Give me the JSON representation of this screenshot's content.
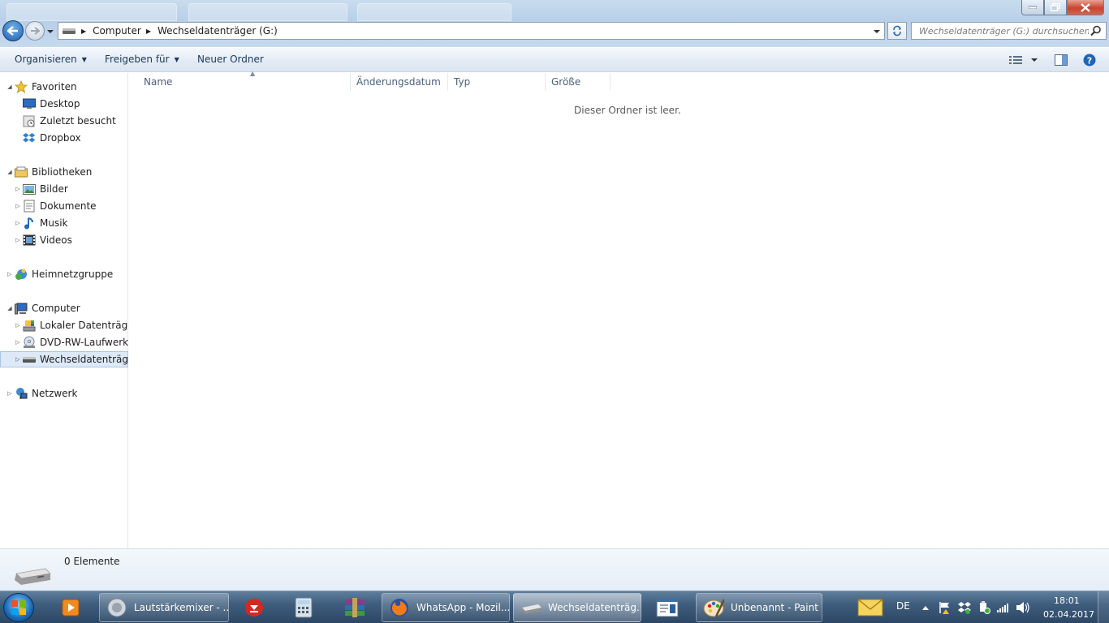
{
  "window": {
    "title": "Wechseldatenträger (G:)"
  },
  "address": {
    "crumbs": [
      "Computer",
      "Wechseldatenträger (G:)"
    ],
    "search_placeholder": "Wechseldatenträger (G:) durchsuchen"
  },
  "toolbar": {
    "organize": "Organisieren",
    "share": "Freigeben für",
    "new_folder": "Neuer Ordner"
  },
  "nav": {
    "favorites": "Favoriten",
    "fav_items": [
      "Desktop",
      "Zuletzt besucht",
      "Dropbox"
    ],
    "libraries": "Bibliotheken",
    "lib_items": [
      "Bilder",
      "Dokumente",
      "Musik",
      "Videos"
    ],
    "homegroup": "Heimnetzgruppe",
    "computer": "Computer",
    "computer_items": [
      "Lokaler Datenträger",
      "DVD-RW-Laufwerk (",
      "Wechseldatenträger"
    ],
    "network": "Netzwerk"
  },
  "columns": [
    "Name",
    "Änderungsdatum",
    "Typ",
    "Größe"
  ],
  "empty_message": "Dieser Ordner ist leer.",
  "details": {
    "count": "0 Elemente"
  },
  "taskbar": {
    "buttons": [
      "Lautstärkemixer - ...",
      "WhatsApp - Mozil...",
      "Wechseldatenträg...",
      "Unbenannt - Paint"
    ],
    "lang": "DE",
    "time": "18:01",
    "date": "02.04.2017"
  },
  "colors": {
    "accent": "#1e395b",
    "selection": "#dde9f7",
    "taskbar": "#3f5d7d"
  }
}
